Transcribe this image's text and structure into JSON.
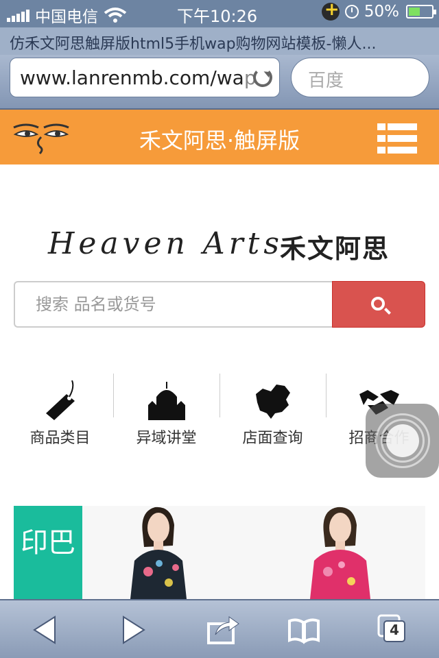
{
  "status_bar": {
    "carrier": "中国电信",
    "time": "下午10:26",
    "battery": "50%",
    "battery_level_percent": 50
  },
  "browser": {
    "page_title": "仿禾文阿思触屏版html5手机wap购物网站模板-懒人...",
    "url_visible": "www.lanrenmb.com/wa",
    "url_faded": "p",
    "search_placeholder": "百度",
    "tab_count": "4"
  },
  "header": {
    "title": "禾文阿思·触屏版"
  },
  "brand": {
    "english": "Heaven Arts",
    "chinese": "禾文阿思"
  },
  "search": {
    "placeholder": "搜索 品名或货号"
  },
  "categories": [
    {
      "label": "商品类目",
      "icon": "tag-icon"
    },
    {
      "label": "异域讲堂",
      "icon": "temple-icon"
    },
    {
      "label": "店面查询",
      "icon": "map-icon"
    },
    {
      "label": "招商合作",
      "icon": "handshake-icon"
    }
  ],
  "featured": {
    "tag_label": "印巴"
  },
  "colors": {
    "header": "#f69b3a",
    "search_button": "#d9534f",
    "tag": "#1abc9c"
  }
}
